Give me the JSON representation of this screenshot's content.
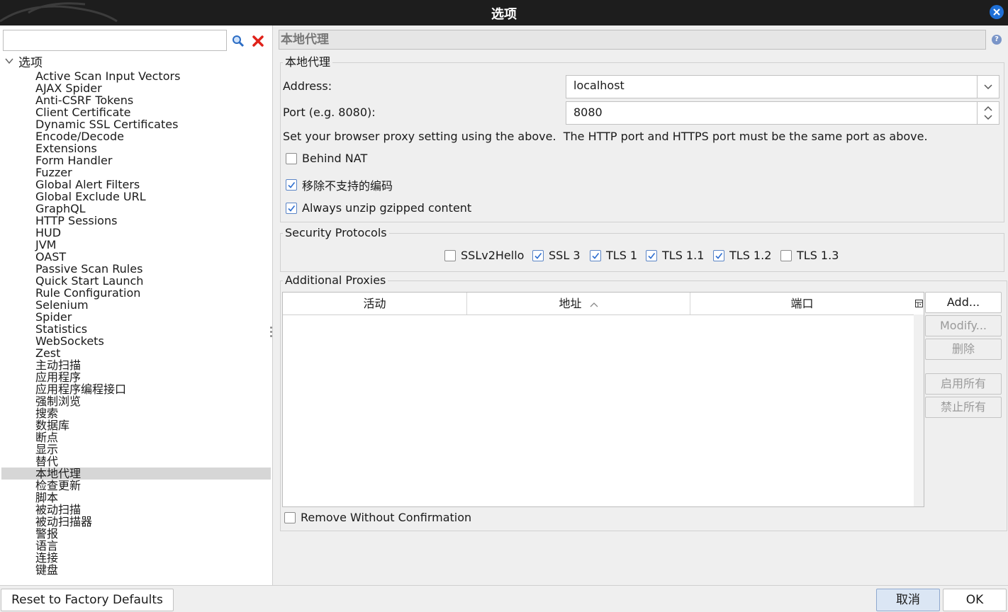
{
  "window": {
    "title": "选项"
  },
  "search": {
    "placeholder": "",
    "value": ""
  },
  "tree": {
    "root_label": "选项",
    "selected_index": 33,
    "items": [
      "Active Scan Input Vectors",
      "AJAX Spider",
      "Anti-CSRF Tokens",
      "Client Certificate",
      "Dynamic SSL Certificates",
      "Encode/Decode",
      "Extensions",
      "Form Handler",
      "Fuzzer",
      "Global Alert Filters",
      "Global Exclude URL",
      "GraphQL",
      "HTTP Sessions",
      "HUD",
      "JVM",
      "OAST",
      "Passive Scan Rules",
      "Quick Start Launch",
      "Rule Configuration",
      "Selenium",
      "Spider",
      "Statistics",
      "WebSockets",
      "Zest",
      "主动扫描",
      "应用程序",
      "应用程序编程接口",
      "强制浏览",
      "搜索",
      "数据库",
      "断点",
      "显示",
      "替代",
      "本地代理",
      "检查更新",
      "脚本",
      "被动扫描",
      "被动扫描器",
      "警报",
      "语言",
      "连接",
      "键盘"
    ]
  },
  "page": {
    "heading": "本地代理"
  },
  "local_proxy": {
    "group_title": "本地代理",
    "address_label": "Address:",
    "address_value": "localhost",
    "port_label": "Port (e.g. 8080):",
    "port_value": "8080",
    "note": "Set your browser proxy setting using the above.  The HTTP port and HTTPS port must be the same port as above.",
    "behind_nat": {
      "label": "Behind NAT",
      "checked": false
    },
    "remove_unsupported": {
      "label": "移除不支持的编码",
      "checked": true
    },
    "always_unzip": {
      "label": "Always unzip gzipped content",
      "checked": true
    }
  },
  "security_protocols": {
    "group_title": "Security Protocols",
    "items": [
      {
        "label": "SSLv2Hello",
        "checked": false
      },
      {
        "label": "SSL 3",
        "checked": true
      },
      {
        "label": "TLS 1",
        "checked": true
      },
      {
        "label": "TLS 1.1",
        "checked": true
      },
      {
        "label": "TLS 1.2",
        "checked": true
      },
      {
        "label": "TLS 1.3",
        "checked": false
      }
    ]
  },
  "additional_proxies": {
    "group_title": "Additional Proxies",
    "columns": [
      "活动",
      "地址",
      "端口"
    ],
    "sorted_column": "地址",
    "rows": [],
    "buttons": {
      "add": "Add...",
      "modify": "Modify...",
      "remove": "删除",
      "enable_all": "启用所有",
      "disable_all": "禁止所有"
    },
    "remove_without_confirmation": {
      "label": "Remove Without Confirmation",
      "checked": false
    }
  },
  "footer": {
    "reset": "Reset to Factory Defaults",
    "cancel": "取消",
    "ok": "OK"
  },
  "colors": {
    "titlebar": "#1d1d1d",
    "accent": "#1e6fd6",
    "selection": "#d6d6d6"
  }
}
